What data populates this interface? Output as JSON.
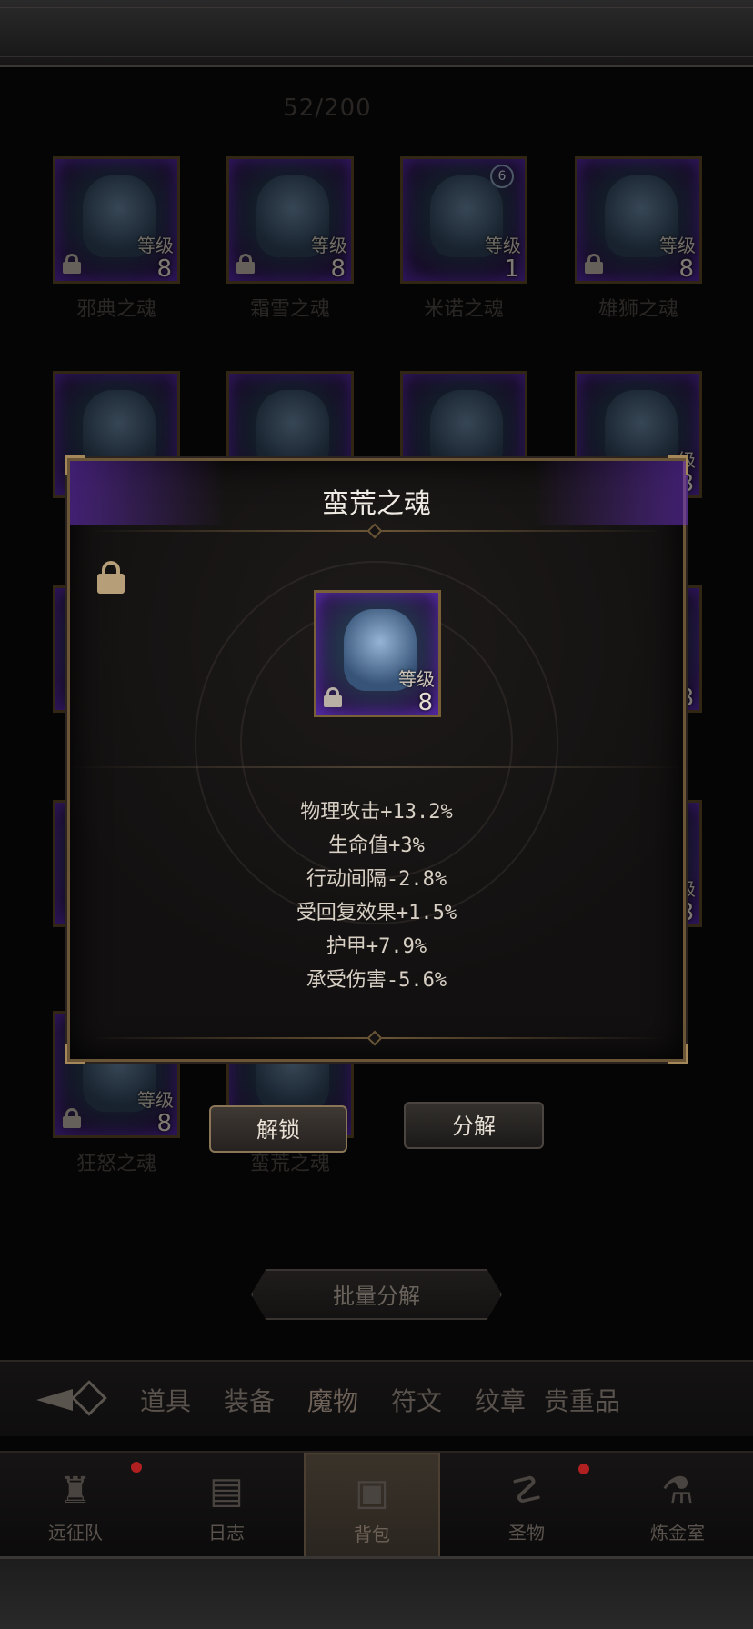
{
  "inventory": {
    "capacity": "52/200",
    "level_label": "等级",
    "row1": [
      {
        "name": "邪典之魂",
        "level": "8",
        "locked": true
      },
      {
        "name": "霜雪之魂",
        "level": "8",
        "locked": true
      },
      {
        "name": "米诺之魂",
        "level": "1",
        "locked": false,
        "star": "6"
      },
      {
        "name": "雄狮之魂",
        "level": "8",
        "locked": true
      }
    ],
    "partial_labels": {
      "r2c4_level_frag": "级",
      "r2c4_level": "8",
      "r3c4_level": "8",
      "r4c4_level_frag": "级",
      "r4c4_level": "8"
    },
    "bottom_row": [
      {
        "name": "狂怒之魂",
        "level": "8",
        "locked": true
      },
      {
        "name": "蛮荒之魂"
      }
    ]
  },
  "modal": {
    "title": "蛮荒之魂",
    "item": {
      "level_label": "等级",
      "level": "8",
      "locked": true
    },
    "attributes": [
      "物理攻击+13.2%",
      "生命值+3%",
      "行动间隔-2.8%",
      "受回复效果+1.5%",
      "护甲+7.9%",
      "承受伤害-5.6%"
    ]
  },
  "buttons": {
    "unlock": "解锁",
    "decompose": "分解",
    "batch_decompose": "批量分解"
  },
  "tabs": [
    "道具",
    "装备",
    "魔物",
    "符文",
    "纹章",
    "贵重品"
  ],
  "active_tab": "魔物",
  "nav": [
    {
      "label": "远征队",
      "icon": "viking-helmet-icon",
      "badge": true
    },
    {
      "label": "日志",
      "icon": "scroll-icon",
      "badge": false
    },
    {
      "label": "背包",
      "icon": "backpack-icon",
      "badge": false,
      "active": true
    },
    {
      "label": "圣物",
      "icon": "chalice-icon",
      "badge": true
    },
    {
      "label": "炼金室",
      "icon": "alchemy-icon",
      "badge": false
    }
  ],
  "colors": {
    "accent_gold": "#8a7656",
    "purple_glow": "#5b2bb0",
    "badge_red": "#b02020"
  }
}
